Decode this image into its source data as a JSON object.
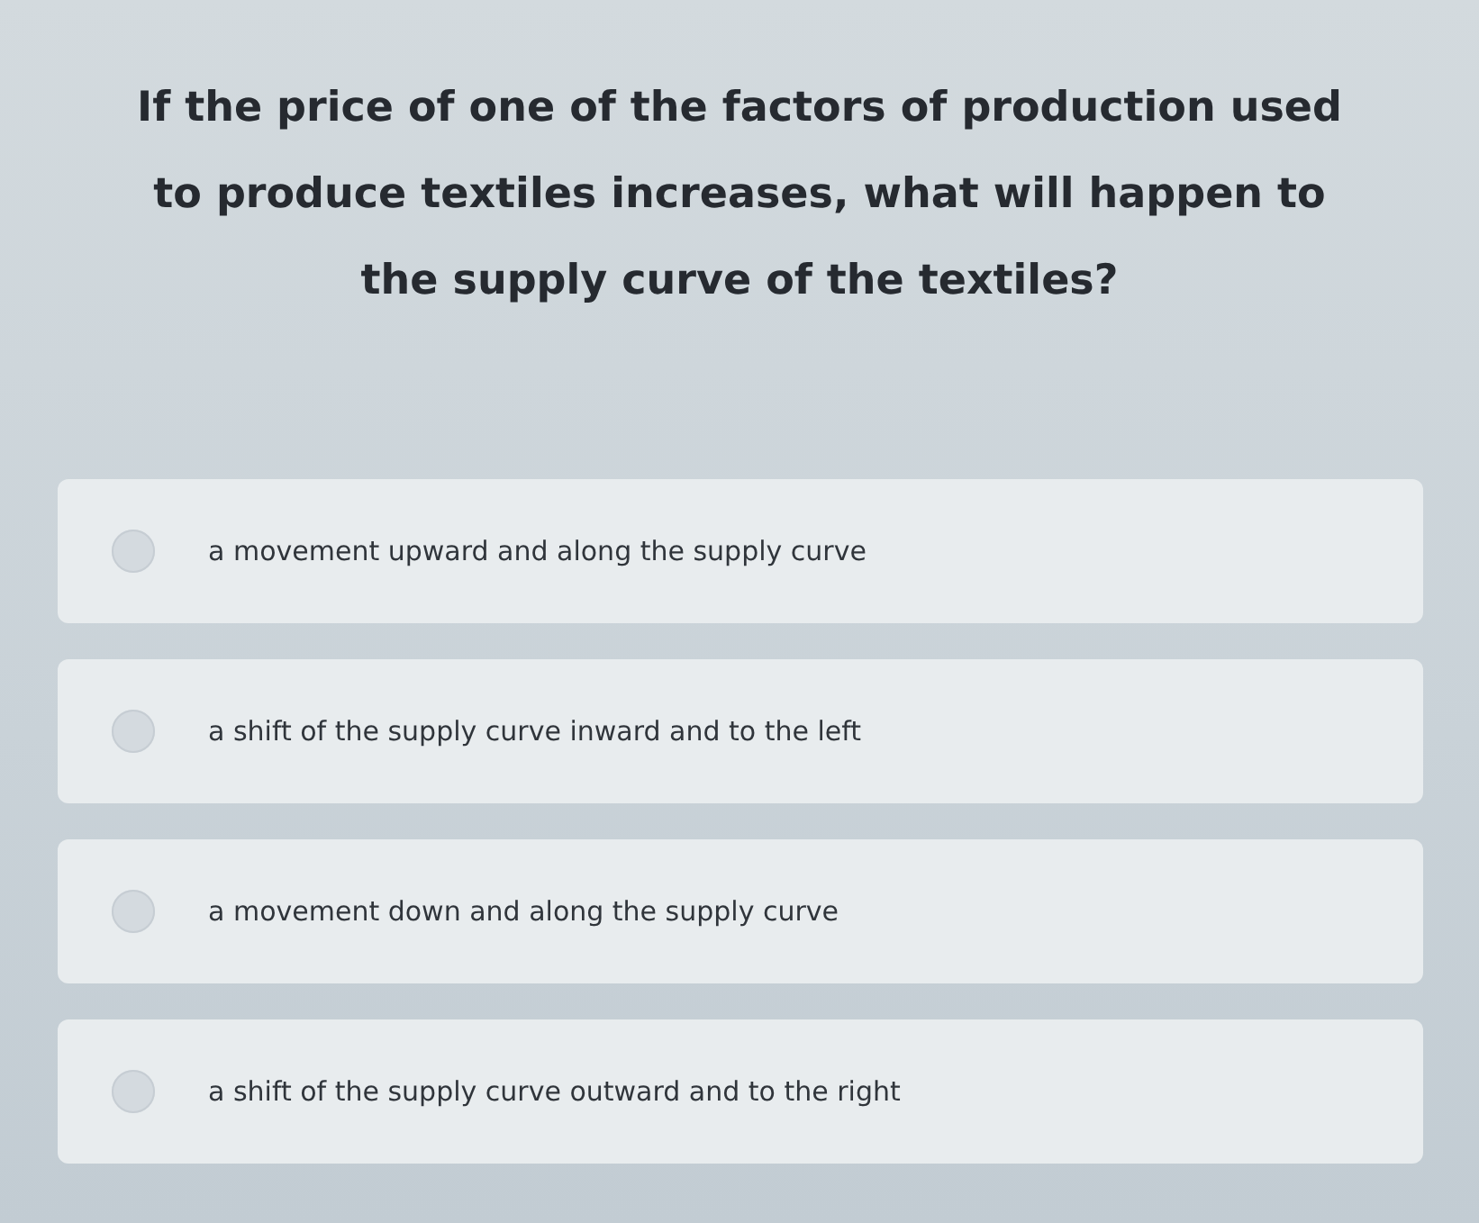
{
  "question": "If the price of one of the factors of production used to produce textiles increases, what will happen to the supply curve of the textiles?",
  "options": [
    {
      "text": "a movement upward and along the supply curve",
      "selected": false
    },
    {
      "text": "a shift of the supply curve inward and to the left",
      "selected": false
    },
    {
      "text": "a movement down and along the supply curve",
      "selected": false
    },
    {
      "text": "a shift of the supply curve outward and to the right",
      "selected": false
    }
  ]
}
